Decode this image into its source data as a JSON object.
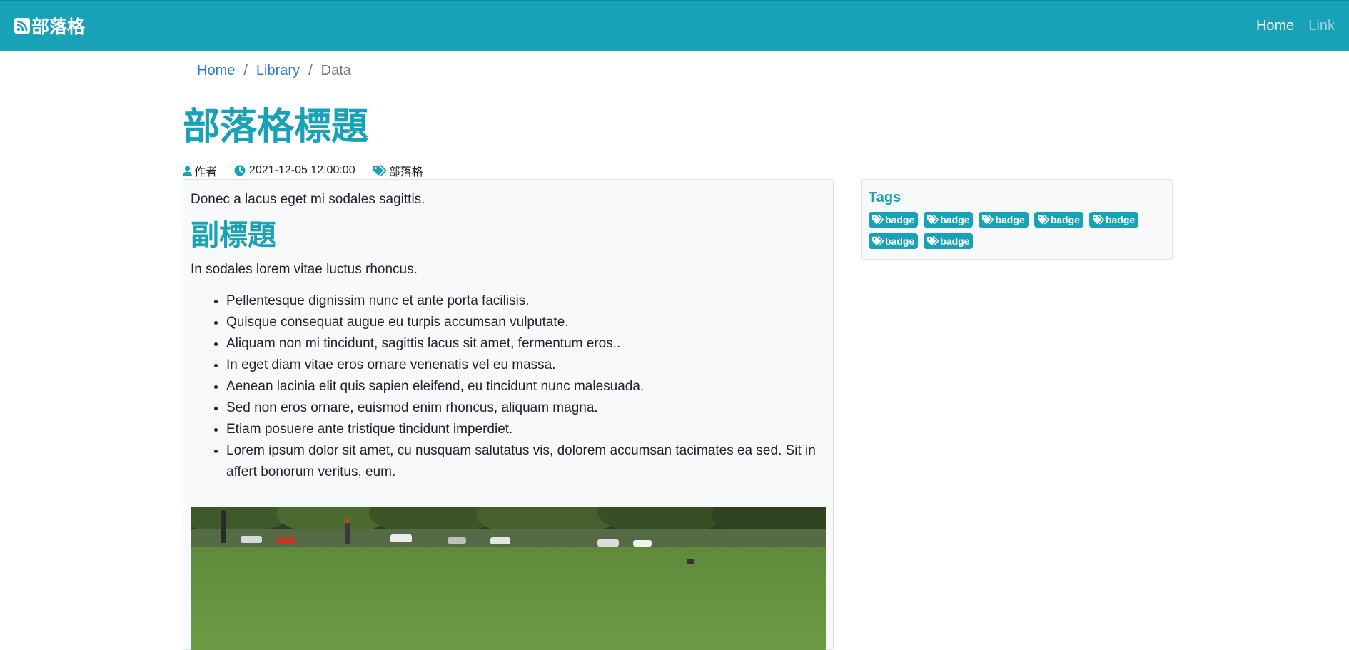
{
  "navbar": {
    "brand": "部落格",
    "links": [
      {
        "label": "Home"
      },
      {
        "label": "Link"
      }
    ]
  },
  "breadcrumb": {
    "items": [
      "Home",
      "Library"
    ],
    "active": "Data"
  },
  "post": {
    "title": "部落格標題",
    "author": "作者",
    "datetime": "2021-12-05 12:00:00",
    "category": "部落格",
    "intro": "Donec a lacus eget mi sodales sagittis.",
    "subheading": "副標題",
    "paragraph": "In sodales lorem vitae luctus rhoncus.",
    "list": [
      "Pellentesque dignissim nunc et ante porta facilisis.",
      "Quisque consequat augue eu turpis accumsan vulputate.",
      "Aliquam non mi tincidunt, sagittis lacus sit amet, fermentum eros..",
      "In eget diam vitae eros ornare venenatis vel eu massa.",
      "Aenean lacinia elit quis sapien eleifend, eu tincidunt nunc malesuada.",
      "Sed non eros ornare, euismod enim rhoncus, aliquam magna.",
      "Etiam posuere ante tristique tincidunt imperdiet.",
      "Lorem ipsum dolor sit amet, cu nusquam salutatus vis, dolorem accumsan tacimates ea sed. Sit in affert bonorum veritus, eum."
    ]
  },
  "sidebar": {
    "tags_title": "Tags",
    "badges": [
      "badge",
      "badge",
      "badge",
      "badge",
      "badge",
      "badge",
      "badge"
    ]
  },
  "colors": {
    "primary": "#17a2b8",
    "link": "#2a7ae2",
    "card_bg": "#f8f9fa"
  },
  "icons": {
    "brand": "rss-icon",
    "author": "user-icon",
    "datetime": "clock-icon",
    "category": "tags-icon",
    "badge": "tags-icon"
  }
}
